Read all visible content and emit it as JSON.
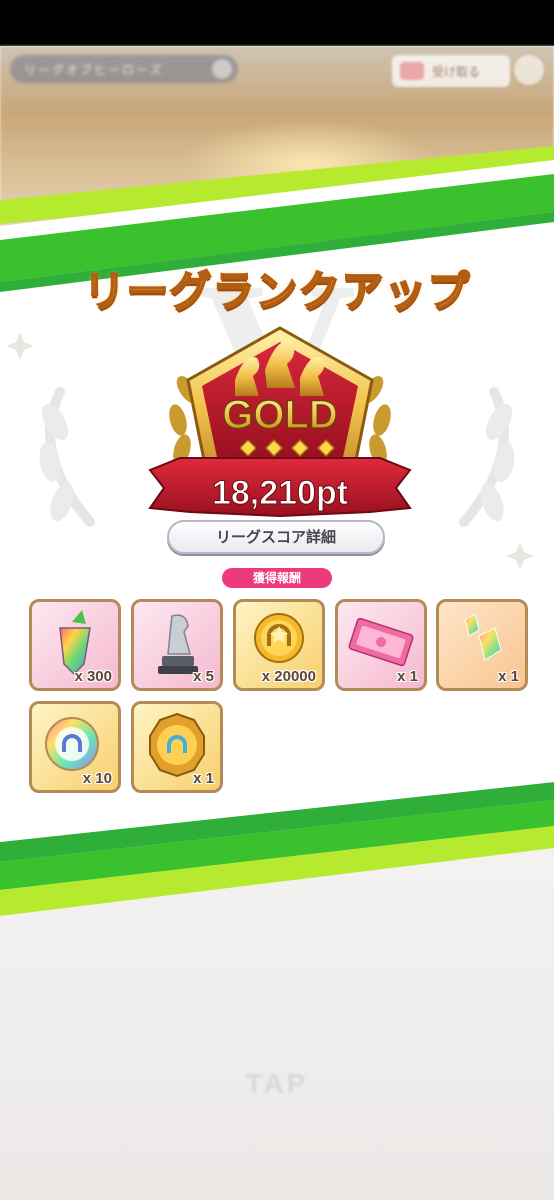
{
  "background": {
    "header_pill_text": "リーグオブヒーローズ",
    "header_button_text": "受け取る",
    "tap_text": "TAP"
  },
  "result": {
    "title": "リーグランクアップ",
    "rank": "GOLD",
    "rank_stars": 4,
    "score": "18,210pt",
    "score_detail_button": "リーグスコア詳細",
    "rewards_label": "獲得報酬"
  },
  "rewards": [
    {
      "item": "rainbow-carrot",
      "qty": "x 300"
    },
    {
      "item": "silver-horse-statue",
      "qty": "x 5"
    },
    {
      "item": "gold-coin",
      "qty": "x 20000"
    },
    {
      "item": "pink-ticket",
      "qty": "x 1"
    },
    {
      "item": "rainbow-crystals",
      "qty": "x 1"
    },
    {
      "item": "rainbow-horseshoe-medal",
      "qty": "x 10"
    },
    {
      "item": "gold-badge",
      "qty": "x 1"
    }
  ],
  "colors": {
    "green_stripe": "#3cc12e",
    "lime_stripe": "#b6ea2f",
    "title_gold": "#f3b43a",
    "rank_red": "#c4182b",
    "label_pink": "#ec3a7d",
    "frame_brown": "#b48a56"
  }
}
